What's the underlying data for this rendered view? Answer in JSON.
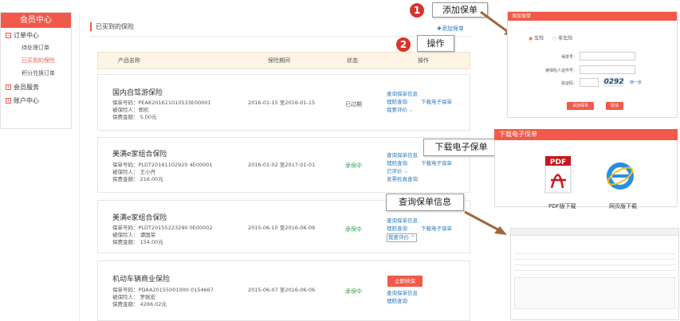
{
  "sidebar": {
    "title": "会员中心",
    "groups": [
      {
        "sign": "−",
        "label": "订单中心"
      },
      {
        "sign": "+",
        "label": "会员服务"
      },
      {
        "sign": "+",
        "label": "账户中心"
      }
    ],
    "subitems": [
      "待处理订单",
      "已买到的保险",
      "积分兑换订单"
    ]
  },
  "main": {
    "title": "已买到的保险",
    "add_label": "✚添加保单",
    "columns": [
      "产品名称",
      "保险期间",
      "状态",
      "操作"
    ],
    "policies": [
      {
        "name": "国内自驾游保险",
        "policy_no": "保单号码：PEAK201611010533E00001",
        "insured": "被保险人：郑凯",
        "amount": "保费金额： 5.00元",
        "period": "2016-01-15 至2016-01-15",
        "status": "已过期",
        "ops_left": [
          "查询保单信息",
          "理赔查询",
          "我要评价 ⌵"
        ],
        "ops_right": [
          "下载电子保单"
        ]
      },
      {
        "name": "美满e家组合保险",
        "policy_no": "保单号码：PLDT20161102920 4E00001",
        "insured": "被保险人： 王小丹",
        "amount": "保费金额： 216.00元",
        "period": "2016-01-02 至2017-01-01",
        "status": "承保中",
        "ops_left": [
          "查询保单信息",
          "理赔查询",
          "已评价 ⌵",
          "发票检真查询"
        ],
        "ops_right": [
          "下载电子保单"
        ]
      },
      {
        "name": "美满e家组合保险",
        "policy_no": "保单号码：PLDT20155223290 0E00002",
        "insured": "被保险人： 谭国荣",
        "amount": "保费金额： 154.00元",
        "period": "2015-06-10 至2016-06-09",
        "status": "承保中",
        "ops_left": [
          "查询保单信息",
          "理赔查询",
          "我要评价 ⌃"
        ],
        "ops_right": [
          "下载电子保单"
        ]
      },
      {
        "name": "机动车辆商业保险",
        "policy_no": "保单号码：PDAA20155001000 0154667",
        "insured": "被保险人： 罗婉宏",
        "amount": "保费金额： 4266.02元",
        "period": "2015-06-07 至2016-06-06",
        "status": "承保中",
        "button": "立即续保",
        "ops_left": [
          "查询保单信息",
          "理赔查询"
        ],
        "ops_right": []
      }
    ]
  },
  "callouts": {
    "add": "添加保单",
    "ops": "操作",
    "download": "下载电子保单",
    "query": "查询保单信息",
    "num1": "1",
    "num2": "2"
  },
  "add_dialog": {
    "title": "添加保单",
    "radio1": "车险",
    "radio2": "非车险",
    "field1": "保单号：",
    "field2": "被保险人证件号：",
    "field3": "验证码：",
    "captcha": "0292",
    "refresh": "换一张",
    "submit": "添加保单",
    "cancel": "取消"
  },
  "download_dialog": {
    "title": "下载电子保单",
    "pdf_label": "PDF版下载",
    "pdf_icon_text": "PDF",
    "web_label": "网页版下载"
  },
  "colors": {
    "accent": "#f15a4a",
    "link": "#2a7ac0",
    "ok": "#3aa35a"
  }
}
